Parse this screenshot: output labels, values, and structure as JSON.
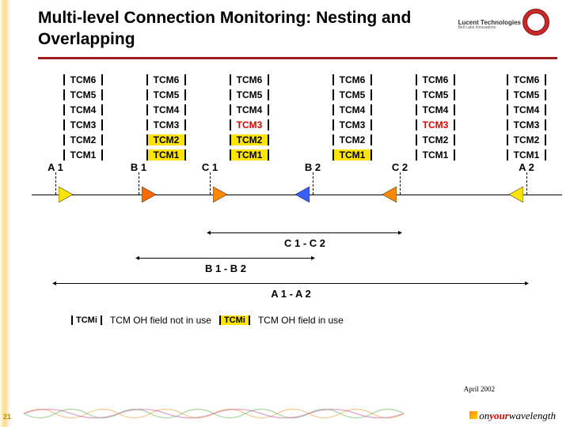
{
  "title": "Multi-level Connection Monitoring: Nesting and Overlapping",
  "brand": {
    "name": "Lucent Technologies",
    "sub": "Bell Labs Innovations"
  },
  "tcm_labels": [
    "TCM6",
    "TCM5",
    "TCM4",
    "TCM3",
    "TCM2",
    "TCM1"
  ],
  "columns": 6,
  "highlight": {
    "tcm3_red_cols": [
      2,
      4
    ],
    "tcm2_yellow_cols": [
      1,
      2
    ],
    "tcm1_yellow_cols": [
      1,
      2,
      3
    ]
  },
  "nodes": [
    "A 1",
    "B 1",
    "C 1",
    "B 2",
    "C 2",
    "A 2"
  ],
  "segments": [
    {
      "label": "C 1 - C 2",
      "extent": [
        2,
        4
      ]
    },
    {
      "label": "B 1 - B 2",
      "extent": [
        1,
        3
      ]
    },
    {
      "label": "A 1 - A 2",
      "extent": [
        0,
        5
      ]
    }
  ],
  "legend": {
    "item_label": "TCMi",
    "not_in_use": "TCM OH field not in use",
    "in_use": "TCM OH field in use"
  },
  "footer_date": "April 2002",
  "page": "21",
  "wavelength_logo": {
    "on": "on",
    "your": "your",
    "rest": "wavelength"
  }
}
